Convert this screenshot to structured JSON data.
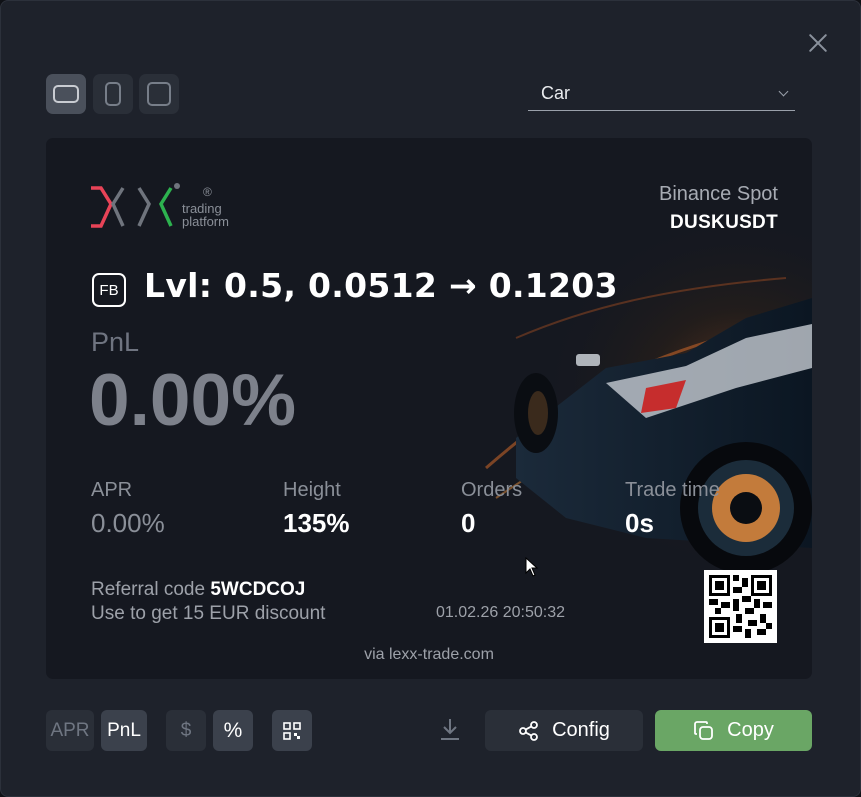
{
  "window": {
    "close_icon": "close-icon"
  },
  "layout_options": [
    {
      "name": "landscape",
      "active": true
    },
    {
      "name": "portrait",
      "active": false
    },
    {
      "name": "square",
      "active": false
    }
  ],
  "theme_select": {
    "value": "Car",
    "icon": "chevron-down-icon"
  },
  "card": {
    "logo": {
      "text_line1": "trading",
      "text_line2": "platform",
      "reg": "®",
      "colors": [
        "#e84357",
        "#2db24f"
      ]
    },
    "exchange": "Binance Spot",
    "pair": "DUSKUSDT",
    "badge": "FB",
    "level_text": "Lvl: 0.5, 0.0512 → 0.1203",
    "pnl_label": "PnL",
    "pnl_value": "0.00%",
    "stats": [
      {
        "label": "APR",
        "value": "0.00%",
        "muted": true
      },
      {
        "label": "Height",
        "value": "135%"
      },
      {
        "label": "Orders",
        "value": "0"
      },
      {
        "label": "Trade time",
        "value": "0s"
      }
    ],
    "referral_prefix": "Referral code",
    "referral_code": "5WCDCOJ",
    "referral_note": "Use to get 15 EUR discount",
    "timestamp": "01.02.26 20:50:32",
    "via": "via lexx-trade.com",
    "background": "race-car-image"
  },
  "toolbar": {
    "apr_label": "APR",
    "pnl_label": "PnL",
    "dollar_label": "$",
    "percent_label": "%",
    "qr_icon": "qr-code-icon",
    "download_icon": "download-icon",
    "config_label": "Config",
    "copy_label": "Copy",
    "accent_green": "#6aa665"
  }
}
